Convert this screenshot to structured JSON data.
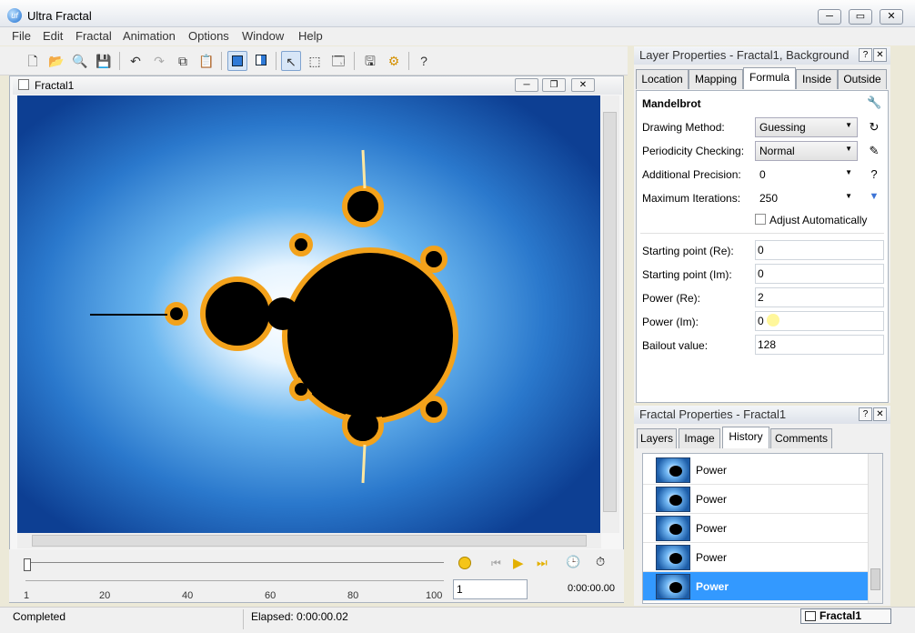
{
  "app": {
    "title": "Ultra Fractal",
    "icon_text": "uf"
  },
  "menu": [
    "File",
    "Edit",
    "Fractal",
    "Animation",
    "Options",
    "Window",
    "Help"
  ],
  "doc": {
    "title": "Fractal1"
  },
  "timeline": {
    "ticks": [
      "1",
      "20",
      "40",
      "60",
      "80",
      "100"
    ],
    "frame_value": "1",
    "time": "0:00:00.00"
  },
  "status": {
    "left": "Completed",
    "elapsed": "Elapsed: 0:00:00.02",
    "tab": "Fractal1"
  },
  "layer_panel": {
    "title": "Layer Properties - Fractal1, Background",
    "tabs": [
      "Location",
      "Mapping",
      "Formula",
      "Inside",
      "Outside"
    ],
    "active_tab": "Formula",
    "formula_name": "Mandelbrot",
    "drawing_method": {
      "label": "Drawing Method:",
      "value": "Guessing"
    },
    "periodicity": {
      "label": "Periodicity Checking:",
      "value": "Normal"
    },
    "precision": {
      "label": "Additional Precision:",
      "value": "0"
    },
    "iterations": {
      "label": "Maximum Iterations:",
      "value": "250"
    },
    "adjust": {
      "label": "Adjust Automatically",
      "checked": false
    },
    "params": [
      {
        "label": "Starting point (Re):",
        "value": "0"
      },
      {
        "label": "Starting point (Im):",
        "value": "0"
      },
      {
        "label": "Power (Re):",
        "value": "2"
      },
      {
        "label": "Power (Im):",
        "value": "0"
      },
      {
        "label": "Bailout value:",
        "value": "128"
      }
    ]
  },
  "fractal_panel": {
    "title": "Fractal Properties - Fractal1",
    "tabs": [
      "Layers",
      "Image",
      "History",
      "Comments"
    ],
    "active_tab": "History",
    "history": [
      "Power",
      "Power",
      "Power",
      "Power",
      "Power"
    ],
    "selected_index": 4
  },
  "icons": {
    "help": "?",
    "close": "✕",
    "undo": "↶",
    "redo": "↷"
  }
}
